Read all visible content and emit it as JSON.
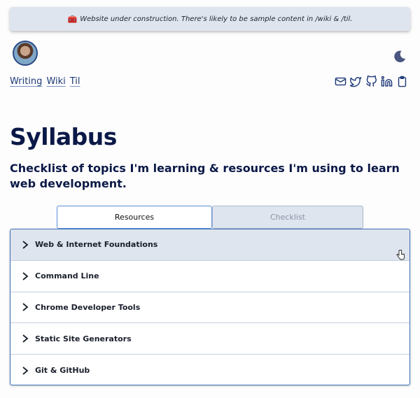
{
  "banner": {
    "icon": "toolbox-icon",
    "text": "Website under construction. There's likely to be sample content in /wiki & /til."
  },
  "header": {
    "avatar": "profile-avatar",
    "theme_toggle_icon": "moon-icon",
    "nav": [
      "Writing",
      "Wiki",
      "Til"
    ],
    "socials": [
      "mail-icon",
      "twitter-icon",
      "github-icon",
      "linkedin-icon",
      "clipboard-icon"
    ]
  },
  "main": {
    "title": "Syllabus",
    "subtitle": "Checklist of topics I'm learning & resources I'm using to learn web development.",
    "tabs": [
      {
        "label": "Resources",
        "active": true
      },
      {
        "label": "Checklist",
        "active": false
      }
    ],
    "accordion": [
      {
        "label": "Web & Internet Foundations",
        "hovered": true
      },
      {
        "label": "Command Line"
      },
      {
        "label": "Chrome Developer Tools"
      },
      {
        "label": "Static Site Generators"
      },
      {
        "label": "Git & GitHub"
      }
    ]
  },
  "colors": {
    "brand_navy": "#0b1947",
    "link": "#1f3a78",
    "banner_bg": "#dfe5ee",
    "tab_active_border": "#5b8fd8",
    "accordion_border": "#3f6fb6"
  }
}
